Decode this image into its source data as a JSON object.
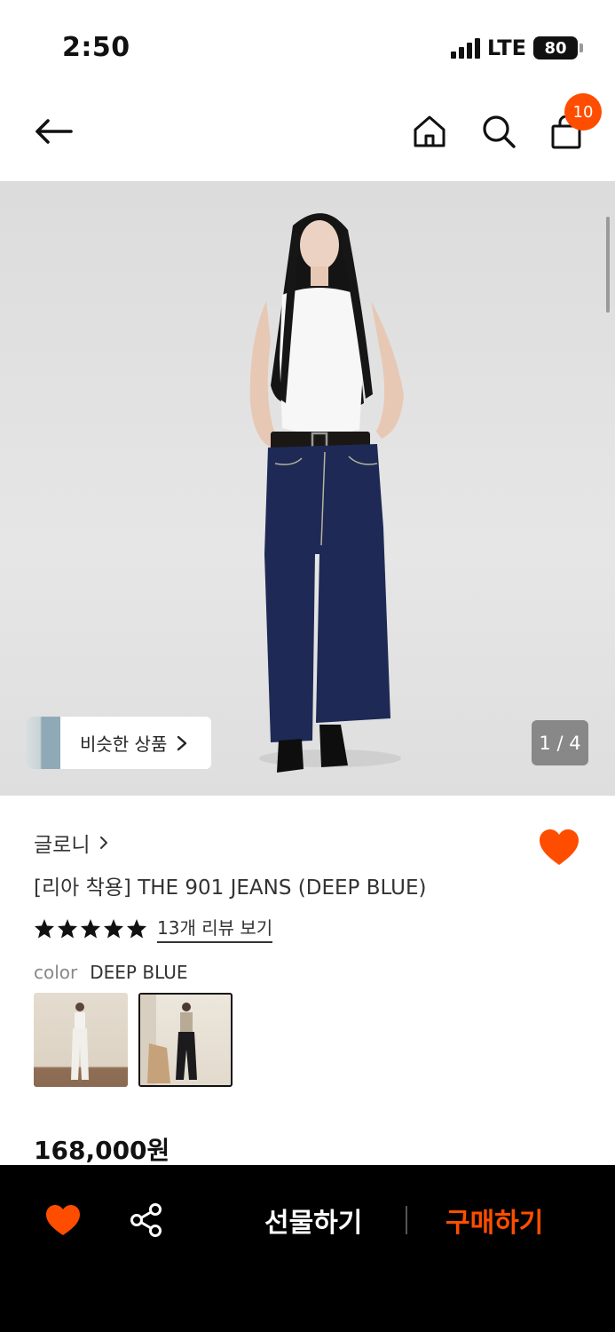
{
  "status_bar": {
    "time": "2:50",
    "network": "LTE",
    "battery": "80"
  },
  "nav": {
    "cart_count": "10",
    "icons": [
      "back-arrow-icon",
      "home-icon",
      "search-icon",
      "shopping-bag-icon"
    ]
  },
  "gallery": {
    "similar_label": "비슷한 상품",
    "page_indicator": "1 / 4"
  },
  "product": {
    "brand": "글로니",
    "title": "[리아 착용] THE 901 JEANS (DEEP BLUE)",
    "rating_stars": 5,
    "review_link": "13개 리뷰 보기",
    "color_label": "color",
    "color_value": "DEEP BLUE",
    "swatch_count": 2,
    "selected_swatch": 2,
    "price": "168,000원",
    "wishlisted": true
  },
  "bottom_bar": {
    "gift_label": "선물하기",
    "buy_label": "구매하기"
  },
  "colors": {
    "accent": "#ff4d00",
    "bottom_bar_bg": "#000000"
  }
}
